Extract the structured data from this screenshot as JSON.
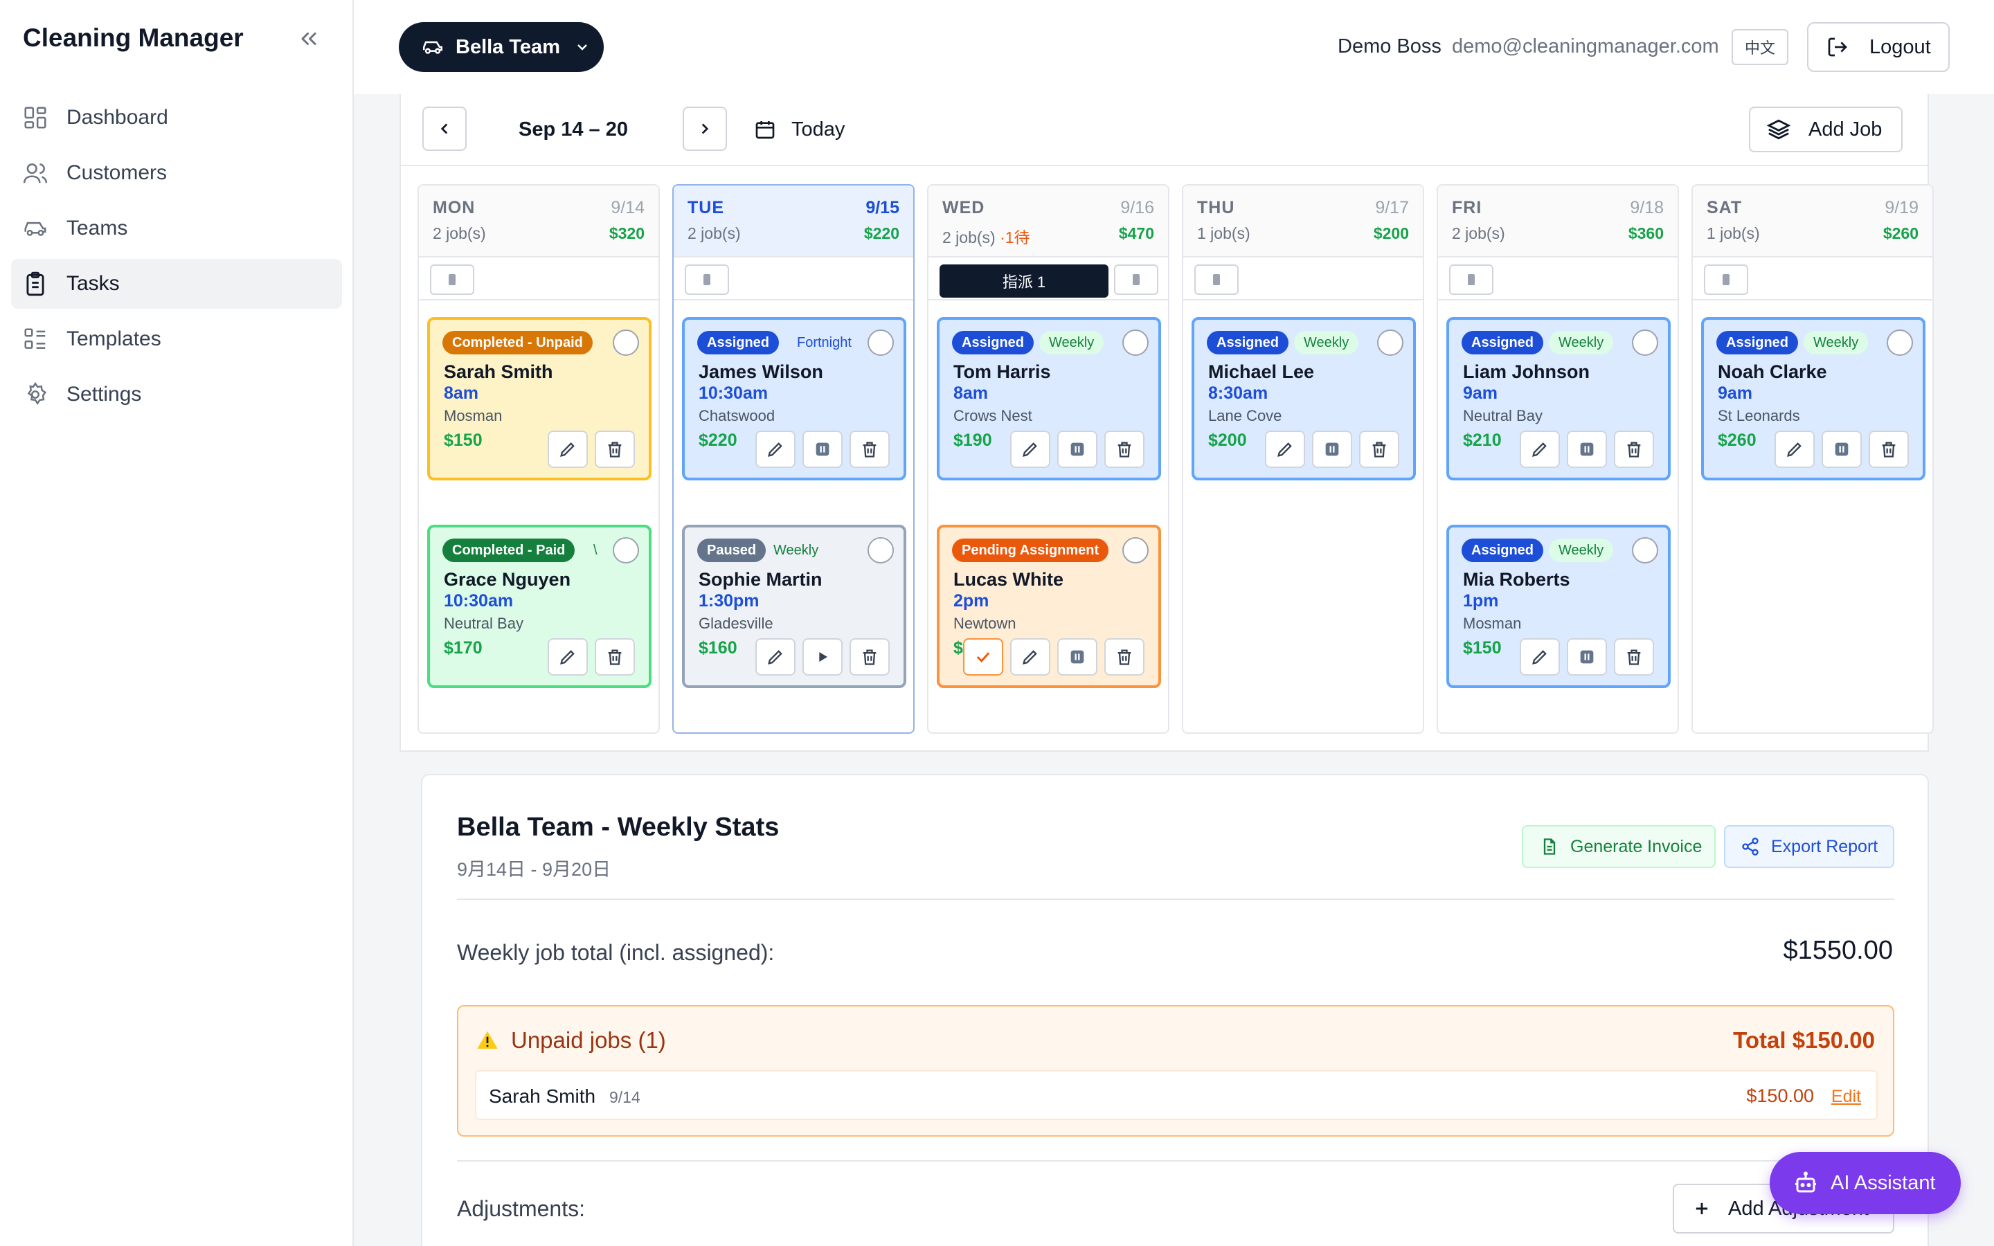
{
  "app": {
    "title": "Cleaning Manager"
  },
  "sidebar": {
    "items": [
      {
        "label": "Dashboard",
        "icon": "dashboard-icon",
        "active": false
      },
      {
        "label": "Customers",
        "icon": "users-icon",
        "active": false
      },
      {
        "label": "Teams",
        "icon": "car-icon",
        "active": false
      },
      {
        "label": "Tasks",
        "icon": "clipboard-icon",
        "active": true
      },
      {
        "label": "Templates",
        "icon": "list-icon",
        "active": false
      },
      {
        "label": "Settings",
        "icon": "gear-icon",
        "active": false
      }
    ]
  },
  "header": {
    "team": "Bella Team",
    "user_name": "Demo Boss",
    "user_email": "demo@cleaningmanager.com",
    "lang": "中文",
    "logout": "Logout"
  },
  "calendar": {
    "range": "Sep 14 – 20",
    "today": "Today",
    "add_job": "Add Job",
    "assign_label": "指派 1",
    "days": [
      {
        "name": "MON",
        "date": "9/14",
        "jobs": "2 job(s)",
        "wait": "",
        "amount": "$320",
        "today": false
      },
      {
        "name": "TUE",
        "date": "9/15",
        "jobs": "2 job(s)",
        "wait": "",
        "amount": "$220",
        "today": true
      },
      {
        "name": "WED",
        "date": "9/16",
        "jobs": "2 job(s)",
        "wait": "·1待",
        "amount": "$470",
        "today": false
      },
      {
        "name": "THU",
        "date": "9/17",
        "jobs": "1 job(s)",
        "wait": "",
        "amount": "$200",
        "today": false
      },
      {
        "name": "FRI",
        "date": "9/18",
        "jobs": "2 job(s)",
        "wait": "",
        "amount": "$360",
        "today": false
      },
      {
        "name": "SAT",
        "date": "9/19",
        "jobs": "1 job(s)",
        "wait": "",
        "amount": "$260",
        "today": false
      }
    ],
    "jobs": [
      {
        "status": "Completed - Unpaid",
        "freq": "",
        "name": "Sarah Smith",
        "time": "8am",
        "location": "Mosman",
        "price": "$150"
      },
      {
        "status": "Completed - Paid",
        "freq": "\\",
        "name": "Grace Nguyen",
        "time": "10:30am",
        "location": "Neutral Bay",
        "price": "$170"
      },
      {
        "status": "Assigned",
        "freq": "Fortnight",
        "name": "James Wilson",
        "time": "10:30am",
        "location": "Chatswood",
        "price": "$220"
      },
      {
        "status": "Paused",
        "freq": "Weekly",
        "name": "Sophie Martin",
        "time": "1:30pm",
        "location": "Gladesville",
        "price": "$160"
      },
      {
        "status": "Assigned",
        "freq": "Weekly",
        "name": "Tom Harris",
        "time": "8am",
        "location": "Crows Nest",
        "price": "$190"
      },
      {
        "status": "Pending Assignment",
        "freq": "",
        "name": "Lucas White",
        "time": "2pm",
        "location": "Newtown",
        "price": "$280"
      },
      {
        "status": "Assigned",
        "freq": "Weekly",
        "name": "Michael Lee",
        "time": "8:30am",
        "location": "Lane Cove",
        "price": "$200"
      },
      {
        "status": "Assigned",
        "freq": "Weekly",
        "name": "Liam Johnson",
        "time": "9am",
        "location": "Neutral Bay",
        "price": "$210"
      },
      {
        "status": "Assigned",
        "freq": "Weekly",
        "name": "Mia Roberts",
        "time": "1pm",
        "location": "Mosman",
        "price": "$150"
      },
      {
        "status": "Assigned",
        "freq": "Weekly",
        "name": "Noah Clarke",
        "time": "9am",
        "location": "St Leonards",
        "price": "$260"
      }
    ]
  },
  "stats": {
    "title": "Bella Team - Weekly Stats",
    "subtitle": "9月14日 - 9月20日",
    "generate_invoice": "Generate Invoice",
    "export_report": "Export Report",
    "weekly_label": "Weekly job total (incl. assigned):",
    "weekly_total": "$1550.00",
    "unpaid_title": "Unpaid jobs (1)",
    "unpaid_total": "Total $150.00",
    "unpaid_rows": [
      {
        "name": "Sarah Smith",
        "date": "9/14",
        "amount": "$150.00",
        "edit": "Edit"
      }
    ],
    "adjustments_label": "Adjustments:",
    "add_adjustment": "Add Adjustment"
  },
  "assistant": {
    "label": "AI Assistant"
  },
  "colors": {
    "accent": "#1d4ed8",
    "brand_dark": "#0f1b2d",
    "success": "#16a34a",
    "warning": "#ea580c",
    "assistant": "#7c3aed"
  }
}
